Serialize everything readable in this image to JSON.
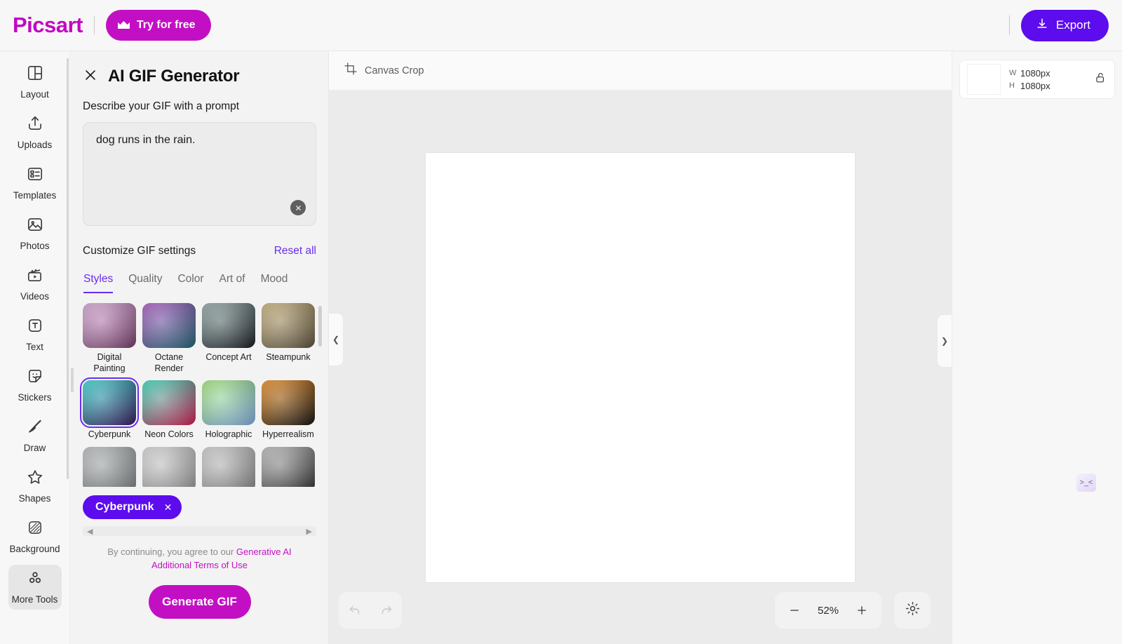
{
  "topbar": {
    "logo": "Picsart",
    "try_label": "Try for free",
    "try_icon": "crown-icon",
    "export_label": "Export",
    "export_icon": "download-icon",
    "brand_color": "#c30fc3",
    "export_color": "#5c0ced"
  },
  "sidebar": {
    "items": [
      {
        "label": "Layout",
        "icon": "layout-icon",
        "active": false
      },
      {
        "label": "Uploads",
        "icon": "upload-icon",
        "active": false
      },
      {
        "label": "Templates",
        "icon": "templates-icon",
        "active": false
      },
      {
        "label": "Photos",
        "icon": "photo-icon",
        "active": false
      },
      {
        "label": "Videos",
        "icon": "video-icon",
        "active": false
      },
      {
        "label": "Text",
        "icon": "text-icon",
        "active": false
      },
      {
        "label": "Stickers",
        "icon": "sticker-icon",
        "active": false
      },
      {
        "label": "Draw",
        "icon": "brush-icon",
        "active": false
      },
      {
        "label": "Shapes",
        "icon": "star-icon",
        "active": false
      },
      {
        "label": "Background",
        "icon": "background-icon",
        "active": false
      },
      {
        "label": "More Tools",
        "icon": "more-tools-icon",
        "active": true
      }
    ]
  },
  "panel": {
    "close_icon": "close-icon",
    "title": "AI GIF Generator",
    "prompt_label": "Describe your GIF with a prompt",
    "prompt_value": "dog runs in the rain.",
    "prompt_placeholder": "Describe your GIF with a prompt",
    "clear_icon": "clear-circle-icon",
    "settings_title": "Customize GIF settings",
    "reset_label": "Reset all",
    "tabs": [
      {
        "label": "Styles",
        "active": true
      },
      {
        "label": "Quality",
        "active": false
      },
      {
        "label": "Color",
        "active": false
      },
      {
        "label": "Art of",
        "active": false
      },
      {
        "label": "Mood",
        "active": false
      }
    ],
    "styles": [
      {
        "name": "Digital Painting",
        "selected": false,
        "c1": "#d9a7d8",
        "c2": "#7b3f6e",
        "kind": "cat"
      },
      {
        "name": "Octane Render",
        "selected": false,
        "c1": "#a84fc0",
        "c2": "#1f6b78",
        "kind": "tree"
      },
      {
        "name": "Concept Art",
        "selected": false,
        "c1": "#8fa8a5",
        "c2": "#151a22",
        "kind": "face"
      },
      {
        "name": "Steampunk",
        "selected": false,
        "c1": "#c9b178",
        "c2": "#5e5440",
        "kind": "machine"
      },
      {
        "name": "Cyberpunk",
        "selected": true,
        "c1": "#2bd9d0",
        "c2": "#3a1560",
        "kind": "city"
      },
      {
        "name": "Neon Colors",
        "selected": false,
        "c1": "#23e0b8",
        "c2": "#e01b55",
        "kind": "neon"
      },
      {
        "name": "Holographic",
        "selected": false,
        "c1": "#9fe870",
        "c2": "#8ab4ef",
        "kind": "holo"
      },
      {
        "name": "Hyperrealism",
        "selected": false,
        "c1": "#f08a14",
        "c2": "#101010",
        "kind": "orange"
      },
      {
        "name": "",
        "selected": false,
        "c1": "#b9bcbd",
        "c2": "#7e8486",
        "kind": "gray1"
      },
      {
        "name": "",
        "selected": false,
        "c1": "#d8d8d8",
        "c2": "#9c9c9c",
        "kind": "gray2"
      },
      {
        "name": "",
        "selected": false,
        "c1": "#cfcfcf",
        "c2": "#8a8a8a",
        "kind": "gray3"
      },
      {
        "name": "",
        "selected": false,
        "c1": "#bdbdbd",
        "c2": "#2e2e2e",
        "kind": "gray4"
      }
    ],
    "chip": {
      "label": "Cyberpunk",
      "remove_icon": "chip-close-icon"
    },
    "legal_prefix": "By continuing, you agree to our ",
    "legal_link": "Generative AI Additional Terms of Use",
    "generate_label": "Generate GIF",
    "accent": "#6a2df0"
  },
  "canvas": {
    "crop_label": "Canvas Crop",
    "crop_icon": "crop-icon",
    "collapse_left_icon": "chevron-left-icon",
    "collapse_right_icon": "chevron-right-icon",
    "undo_icon": "undo-icon",
    "redo_icon": "redo-icon",
    "zoom_out_icon": "minus-icon",
    "zoom_in_icon": "plus-icon",
    "zoom_value": "52%",
    "settings_icon": "gear-icon"
  },
  "rightbar": {
    "width_key": "W",
    "width_value": "1080px",
    "height_key": "H",
    "height_value": "1080px",
    "lock_icon": "unlock-icon"
  },
  "widget": {
    "face": ">_<",
    "name": "chat-widget-icon"
  }
}
